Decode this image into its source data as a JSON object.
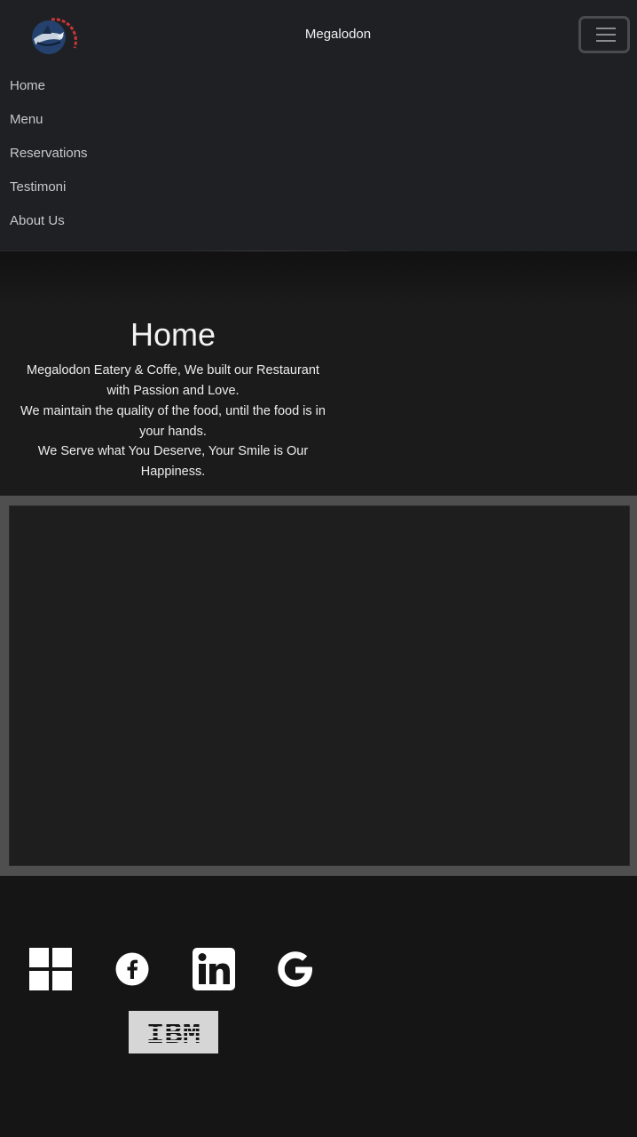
{
  "brand": {
    "name": "Megalodon",
    "logo": "megalodon-shark-logo"
  },
  "nav": {
    "toggle": "hamburger-icon",
    "items": [
      {
        "label": "Home"
      },
      {
        "label": "Menu"
      },
      {
        "label": "Reservations"
      },
      {
        "label": "Testimoni"
      },
      {
        "label": "About Us"
      }
    ]
  },
  "hero": {
    "title": "Home",
    "lines": [
      "Megalodon Eatery & Coffe, We built our Restaurant",
      "with Passion and Love.",
      "We maintain the quality of the food, until the food is in",
      "your hands.",
      "We Serve what You Deserve, Your Smile is Our",
      "Happiness."
    ]
  },
  "map": {
    "content": "embedded-map"
  },
  "footer": {
    "icons": [
      "windows-icon",
      "facebook-icon",
      "linkedin-icon",
      "google-icon",
      "ibm-icon"
    ],
    "ibm_label": "IBM"
  },
  "colors": {
    "navbar": "#1f2023",
    "background": "#151516",
    "hero": "#1b1b1c",
    "frame": "#4f4f50"
  }
}
